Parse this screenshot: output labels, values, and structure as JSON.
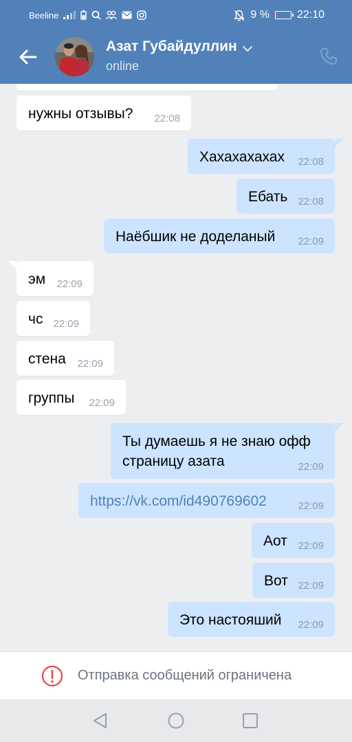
{
  "status_bar": {
    "carrier": "Beeline",
    "battery_percent": "9 %",
    "time": "22:10",
    "icons": [
      "signal-icon",
      "battery-small-icon",
      "search-icon",
      "people-icon",
      "mail-icon",
      "instagram-icon",
      "mute-icon",
      "battery-icon"
    ]
  },
  "header": {
    "contact_name": "Азат Губайдуллин",
    "status": "online",
    "icons": [
      "back-arrow-icon",
      "chevron-down-icon",
      "phone-icon"
    ]
  },
  "messages": [
    {
      "dir": "in",
      "text": "нужны отзывы?",
      "time": "22:08"
    },
    {
      "dir": "out",
      "text": "Хахахахахах",
      "time": "22:08"
    },
    {
      "dir": "out",
      "text": "Ебать",
      "time": "22:08"
    },
    {
      "dir": "out",
      "text": "Наёбшик не доделаный",
      "time": "22:09"
    },
    {
      "dir": "in",
      "text": "эм",
      "time": "22:09"
    },
    {
      "dir": "in",
      "text": "чс",
      "time": "22:09"
    },
    {
      "dir": "in",
      "text": "стена",
      "time": "22:09"
    },
    {
      "dir": "in",
      "text": "группы",
      "time": "22:09"
    },
    {
      "dir": "out",
      "text_line1": "Ты думаешь я не знаю офф",
      "text_line2": "страницу азата",
      "time": "22:09"
    },
    {
      "dir": "out",
      "text": "https://vk.com/id490769602",
      "time": "22:09",
      "is_link": true
    },
    {
      "dir": "out",
      "text": "Аот",
      "time": "22:09"
    },
    {
      "dir": "out",
      "text": "Вот",
      "time": "22:09"
    },
    {
      "dir": "out",
      "text": "Это настояший",
      "time": "22:09"
    }
  ],
  "footer": {
    "restricted_text": "Отправка сообщений ограничена",
    "icon": "warning-circle-icon"
  },
  "nav_bar": {
    "icons": [
      "nav-back-icon",
      "nav-home-icon",
      "nav-recents-icon"
    ]
  },
  "colors": {
    "accent": "#5181b8",
    "outgoing_bubble": "#cce4ff",
    "incoming_bubble": "#ffffff",
    "background": "#edeef0",
    "warning": "#e64646"
  }
}
